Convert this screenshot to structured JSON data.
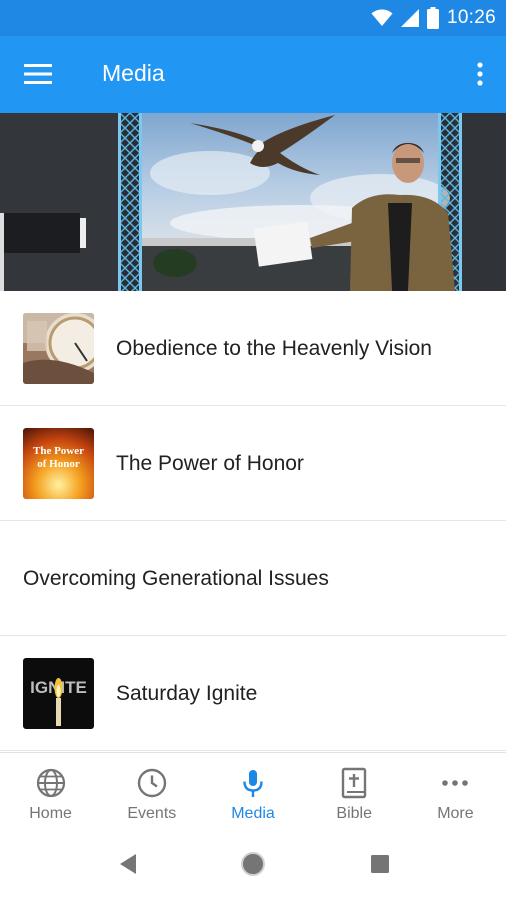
{
  "status_bar": {
    "time": "10:26",
    "icons": [
      "wifi-icon",
      "cell-signal-icon",
      "battery-icon"
    ]
  },
  "app_bar": {
    "title": "Media",
    "menu_icon": "hamburger-menu-icon",
    "overflow_icon": "more-vert-icon",
    "color": "#2196f3"
  },
  "hero": {
    "image": "speaker-on-stage-with-eagle-backdrop"
  },
  "media_list": {
    "items": [
      {
        "title": "Obedience to the Heavenly Vision",
        "thumbnail": "compass-thumbnail"
      },
      {
        "title": "The Power of Honor",
        "thumbnail": "power-of-honor-thumbnail",
        "thumbnail_text": "The Power of Honor"
      },
      {
        "title": "Overcoming Generational Issues",
        "thumbnail": null
      },
      {
        "title": "Saturday Ignite",
        "thumbnail": "ignite-thumbnail",
        "thumbnail_text": "IGNITE"
      }
    ]
  },
  "bottom_nav": {
    "active": "Media",
    "accent_color": "#1e88e5",
    "items": [
      {
        "label": "Home",
        "icon": "globe-icon"
      },
      {
        "label": "Events",
        "icon": "clock-icon"
      },
      {
        "label": "Media",
        "icon": "microphone-icon"
      },
      {
        "label": "Bible",
        "icon": "bible-icon"
      },
      {
        "label": "More",
        "icon": "more-horiz-icon"
      }
    ]
  },
  "system_nav": {
    "buttons": [
      "back-icon",
      "home-circle-icon",
      "recents-icon"
    ]
  }
}
